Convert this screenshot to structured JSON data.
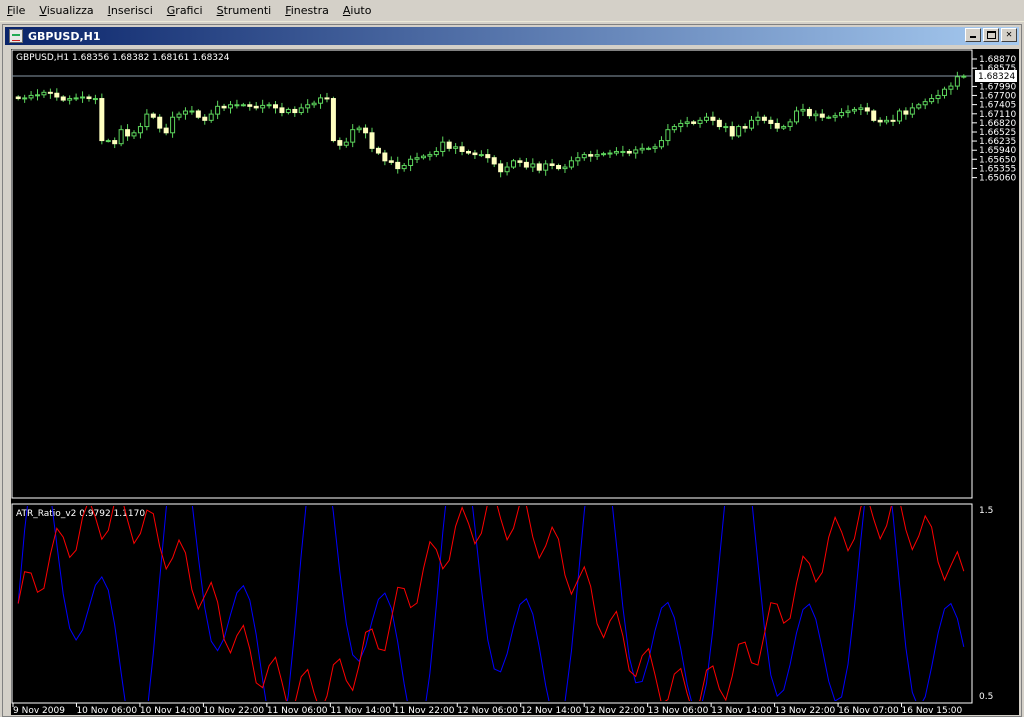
{
  "menu": {
    "items": [
      {
        "label": "File",
        "underline": "F"
      },
      {
        "label": "Visualizza",
        "underline": "V"
      },
      {
        "label": "Inserisci",
        "underline": "I"
      },
      {
        "label": "Grafici",
        "underline": "G"
      },
      {
        "label": "Strumenti",
        "underline": "S"
      },
      {
        "label": "Finestra",
        "underline": "F"
      },
      {
        "label": "Aiuto",
        "underline": "A"
      }
    ]
  },
  "window": {
    "title": "GBPUSD,H1",
    "buttons": [
      "minimize",
      "restore",
      "close"
    ]
  },
  "chart_data": {
    "type": "candlestick",
    "symbol_info": "GBPUSD,H1  1.68356 1.68382 1.68161 1.68324",
    "price_axis": {
      "min": 1.5506,
      "max": 1.6887,
      "ticks": [
        "1.68870",
        "1.68575",
        "1.68324",
        "1.67990",
        "1.67700",
        "1.67405",
        "1.67110",
        "1.66820",
        "1.66525",
        "1.66235",
        "1.65940",
        "1.65650",
        "1.65355",
        "1.65060"
      ],
      "current_price": "1.68324"
    },
    "time_axis": [
      "9 Nov 2009",
      "10 Nov 06:00",
      "10 Nov 14:00",
      "10 Nov 22:00",
      "11 Nov 06:00",
      "11 Nov 14:00",
      "11 Nov 22:00",
      "12 Nov 06:00",
      "12 Nov 14:00",
      "12 Nov 22:00",
      "13 Nov 06:00",
      "13 Nov 14:00",
      "13 Nov 22:00",
      "16 Nov 07:00",
      "16 Nov 15:00"
    ],
    "candles_close": [
      1.676,
      1.6762,
      1.677,
      1.6772,
      1.678,
      1.6777,
      1.6765,
      1.6755,
      1.676,
      1.6762,
      1.6765,
      1.676,
      1.676,
      1.6625,
      1.6625,
      1.6615,
      1.666,
      1.664,
      1.665,
      1.667,
      1.671,
      1.67,
      1.6665,
      1.665,
      1.67,
      1.671,
      1.672,
      1.672,
      1.67,
      1.669,
      1.671,
      1.6735,
      1.673,
      1.674,
      1.674,
      1.674,
      1.6735,
      1.673,
      1.6738,
      1.674,
      1.673,
      1.6715,
      1.6725,
      1.6715,
      1.673,
      1.674,
      1.6745,
      1.6762,
      1.676,
      1.6625,
      1.661,
      1.662,
      1.666,
      1.6665,
      1.665,
      1.66,
      1.6585,
      1.656,
      1.6555,
      1.6535,
      1.6545,
      1.6565,
      1.657,
      1.6575,
      1.658,
      1.659,
      1.662,
      1.66,
      1.6605,
      1.659,
      1.6585,
      1.658,
      1.658,
      1.657,
      1.655,
      1.6525,
      1.654,
      1.656,
      1.6555,
      1.654,
      1.655,
      1.653,
      1.655,
      1.6545,
      1.6535,
      1.654,
      1.656,
      1.657,
      1.658,
      1.6575,
      1.658,
      1.6583,
      1.6585,
      1.659,
      1.659,
      1.6585,
      1.6595,
      1.66,
      1.66,
      1.6605,
      1.6625,
      1.666,
      1.667,
      1.668,
      1.6685,
      1.668,
      1.669,
      1.67,
      1.669,
      1.667,
      1.667,
      1.664,
      1.667,
      1.6665,
      1.669,
      1.67,
      1.669,
      1.668,
      1.6665,
      1.667,
      1.6685,
      1.672,
      1.6725,
      1.6705,
      1.671,
      1.67,
      1.67,
      1.6705,
      1.6715,
      1.672,
      1.6725,
      1.673,
      1.672,
      1.669,
      1.6685,
      1.669,
      1.6688,
      1.672,
      1.671,
      1.673,
      1.674,
      1.675,
      1.676,
      1.677,
      1.679,
      1.68,
      1.683,
      1.6832
    ],
    "indicator": {
      "name": "ATR_Ratio_v2",
      "label": "ATR_Ratio_v2 0.9792 1.1170",
      "values": [
        0.9792,
        1.117
      ],
      "axis_max": "1.5",
      "axis_min": "0.5",
      "series": [
        {
          "color": "#ff0000"
        },
        {
          "color": "#0000ff"
        }
      ]
    }
  }
}
